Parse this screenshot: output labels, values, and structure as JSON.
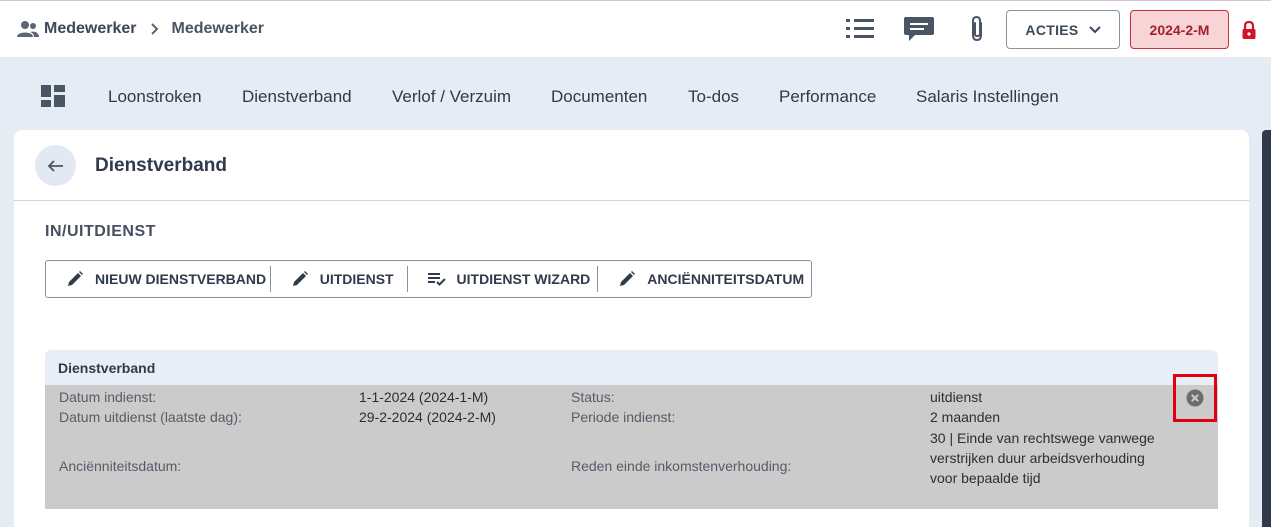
{
  "breadcrumb": {
    "root": "Medewerker",
    "current": "Medewerker"
  },
  "header": {
    "acties_label": "ACTIES",
    "period_label": "2024-2-M"
  },
  "tabs": [
    {
      "label": "Loonstroken"
    },
    {
      "label": "Dienstverband"
    },
    {
      "label": "Verlof / Verzuim"
    },
    {
      "label": "Documenten"
    },
    {
      "label": "To-dos"
    },
    {
      "label": "Performance"
    },
    {
      "label": "Salaris Instellingen"
    }
  ],
  "page": {
    "title": "Dienstverband",
    "section_title": "IN/UITDIENST"
  },
  "actions": {
    "nieuw": "NIEUW DIENSTVERBAND",
    "uitdienst": "UITDIENST",
    "wizard": "UITDIENST WIZARD",
    "anciennititeit": "ANCIËNNITEITSDATUM"
  },
  "panel": {
    "title": "Dienstverband",
    "datum_indienst_label": "Datum indienst:",
    "datum_indienst_value": "1-1-2024 (2024-1-M)",
    "datum_uitdienst_label": "Datum uitdienst (laatste dag):",
    "datum_uitdienst_value": "29-2-2024 (2024-2-M)",
    "anciennititeit_label": "Anciënniteitsdatum:",
    "status_label": "Status:",
    "status_value": "uitdienst",
    "periode_label": "Periode indienst:",
    "periode_value": "2 maanden",
    "reden_label": "Reden einde inkomstenverhouding:",
    "reden_value": "30 | Einde van rechtswege vanwege verstrijken duur arbeidsverhouding voor bepaalde tijd"
  },
  "colors": {
    "accent_red": "#c9303a",
    "highlight_box": "#e0000f",
    "page_bg": "#e6ecf3",
    "row_bg": "#cbcbcb"
  },
  "icons": [
    "users-icon",
    "chevron-right-icon",
    "list-icon",
    "chat-icon",
    "paperclip-icon",
    "chevron-down-icon",
    "lock-icon",
    "dashboard-icon",
    "arrow-left-icon",
    "pencil-icon",
    "checklist-icon",
    "remove-circle-icon"
  ]
}
